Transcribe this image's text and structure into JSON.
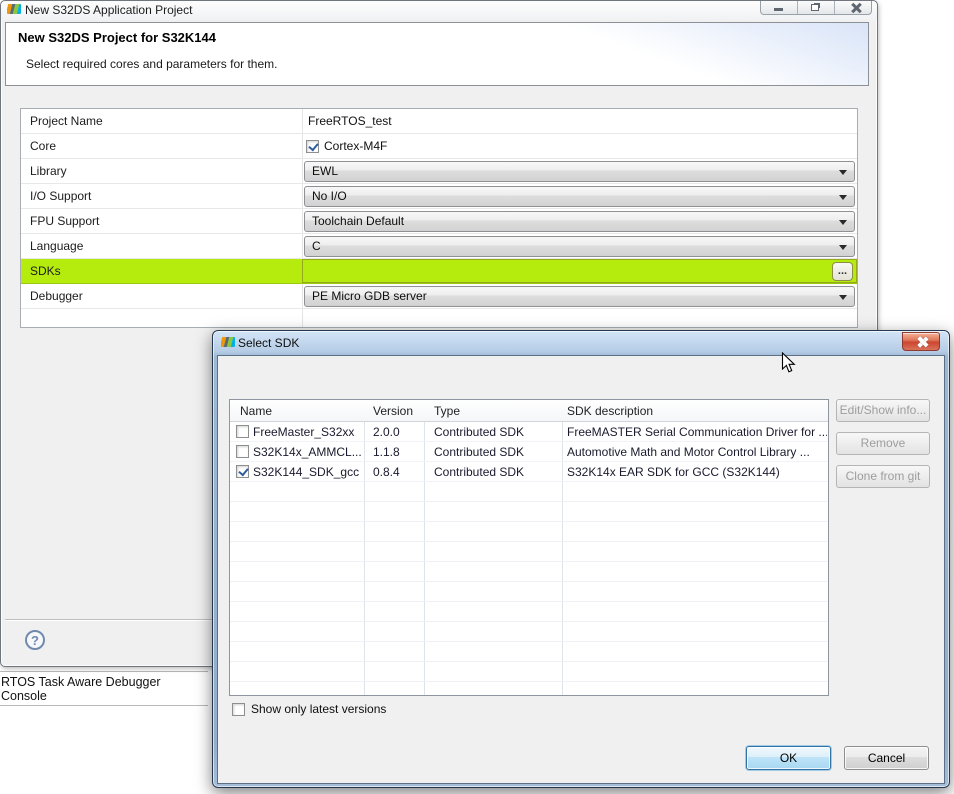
{
  "background": {
    "console_text": "RTOS Task Aware Debugger Console"
  },
  "main_window": {
    "title": "New S32DS Application Project",
    "header": {
      "title": "New S32DS Project for S32K144",
      "subtitle": "Select required cores and parameters for them."
    },
    "form": {
      "rows": [
        {
          "label": "Project Name",
          "type": "text",
          "value": "FreeRTOS_test"
        },
        {
          "label": "Core",
          "type": "checkbox",
          "value": "Cortex-M4F",
          "checked": true
        },
        {
          "label": "Library",
          "type": "combo",
          "value": "EWL"
        },
        {
          "label": "I/O Support",
          "type": "combo",
          "value": "No I/O"
        },
        {
          "label": "FPU Support",
          "type": "combo",
          "value": "Toolchain Default"
        },
        {
          "label": "Language",
          "type": "combo",
          "value": "C"
        },
        {
          "label": "SDKs",
          "type": "sdk",
          "value": "",
          "browse_label": "...",
          "highlighted": true
        },
        {
          "label": "Debugger",
          "type": "combo",
          "value": "PE Micro GDB server"
        }
      ]
    },
    "help_label": "?"
  },
  "sdk_dialog": {
    "title": "Select SDK",
    "table": {
      "columns": [
        "Name",
        "Version",
        "Type",
        "SDK description"
      ],
      "rows": [
        {
          "checked": false,
          "name": "FreeMaster_S32xx",
          "version": "2.0.0",
          "type": "Contributed SDK",
          "description": "FreeMASTER Serial Communication Driver for ..."
        },
        {
          "checked": false,
          "name": "S32K14x_AMMCL...",
          "version": "1.1.8",
          "type": "Contributed SDK",
          "description": "Automotive Math and Motor Control Library ..."
        },
        {
          "checked": true,
          "name": "S32K144_SDK_gcc",
          "version": "0.8.4",
          "type": "Contributed SDK",
          "description": "S32K14x EAR SDK for GCC (S32K144)"
        }
      ]
    },
    "side_buttons": [
      {
        "label": "Edit/Show info...",
        "enabled": false
      },
      {
        "label": "Remove",
        "enabled": false
      },
      {
        "label": "Clone from git",
        "enabled": false
      }
    ],
    "show_latest_label": "Show only latest versions",
    "show_latest_checked": false,
    "ok_label": "OK",
    "cancel_label": "Cancel"
  },
  "colors": {
    "sdk_row_highlight": "#b5ec0d",
    "close_button_red": "#cc4630",
    "default_button_border": "#2f73a4",
    "dialog_frame_blue": "#9db8d4"
  }
}
